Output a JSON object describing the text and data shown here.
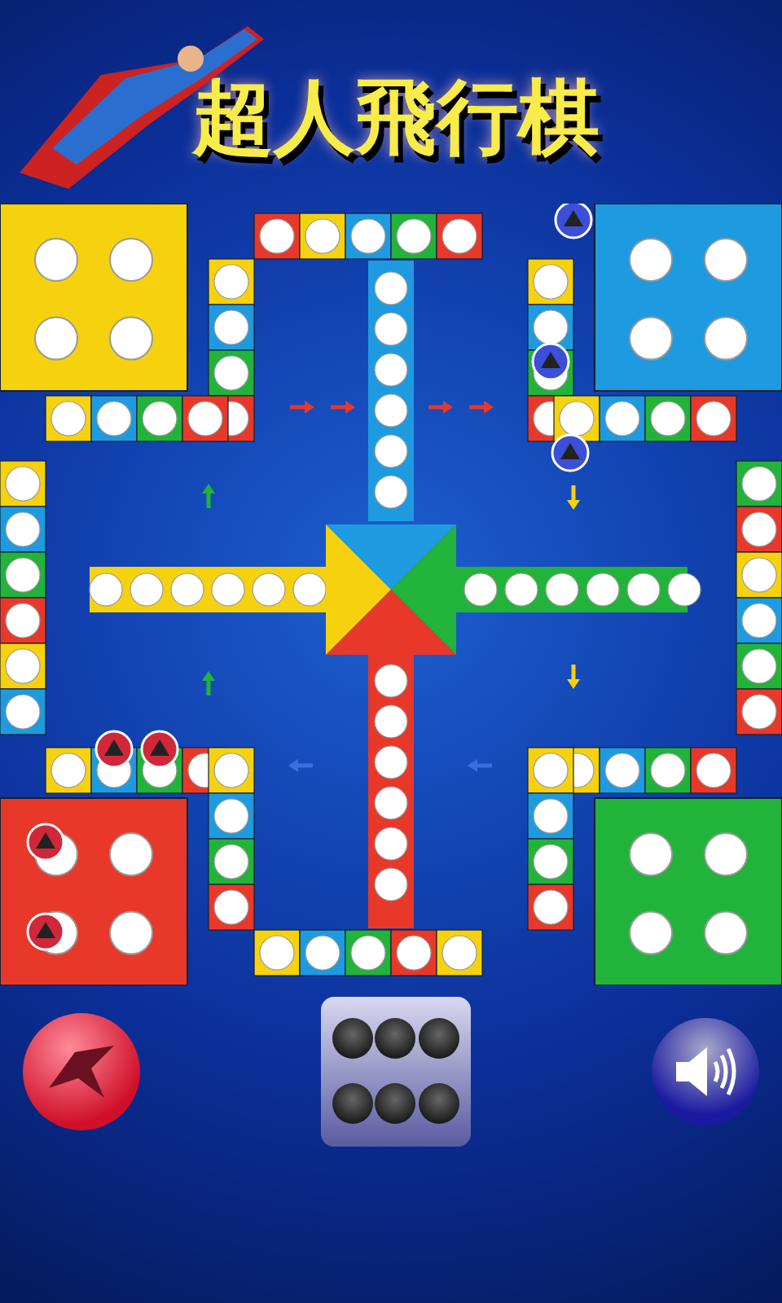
{
  "title": "超人飛行棋",
  "sound": {
    "on": true
  }
}
